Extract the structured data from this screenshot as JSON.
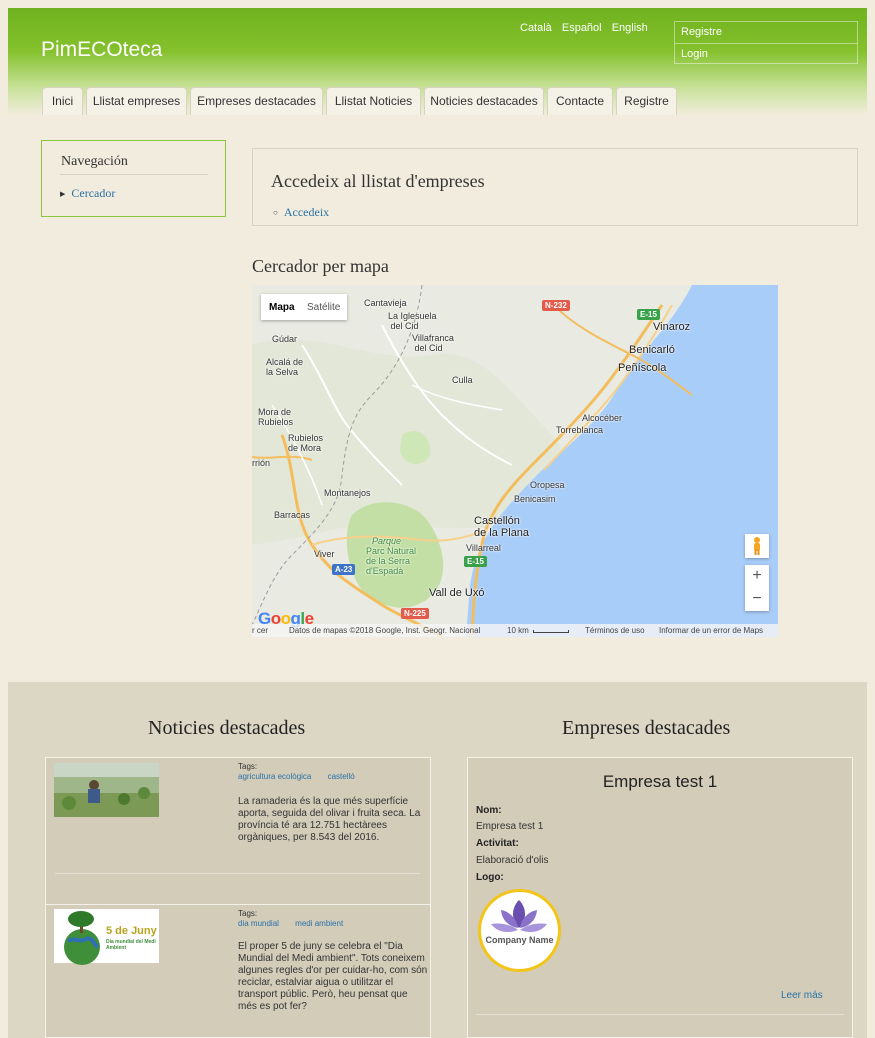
{
  "site": {
    "name": "PimECOteca"
  },
  "languages": [
    "Català",
    "Español",
    "English"
  ],
  "user_menu": {
    "register": "Registre",
    "login": "Login"
  },
  "tabs": [
    "Inici",
    "Llistat empreses",
    "Empreses destacades",
    "Llistat Noticies",
    "Noticies destacades",
    "Contacte",
    "Registre"
  ],
  "sidebar": {
    "title": "Navegación",
    "items": [
      "Cercador"
    ]
  },
  "listing": {
    "title": "Accedeix al llistat d'empreses",
    "link": "Accedeix"
  },
  "map": {
    "title": "Cercador per mapa",
    "type_buttons": [
      "Mapa",
      "Satélite"
    ],
    "labels": {
      "cantavieja": "Cantavieja",
      "iglesuela": "La Iglesuela\n del Cid",
      "villafranca": "Villafranca\n del Cid",
      "gudar": "Gúdar",
      "alcala": "Alcalá de\nla Selva",
      "vinaroz": "Vinaroz",
      "benicarlo": "Benicarló",
      "peniscola": "Peñíscola",
      "culla": "Culla",
      "mora": "Mora de\nRubielos",
      "rubielos": "Rubielos\nde Mora",
      "alcocebre": "Alcocéber",
      "torreblanca": "Torreblanca",
      "teruel": "rrión",
      "oropesa": "Oropesa",
      "montanejos": "Montanejos",
      "benicasim": "Benicasim",
      "barracas": "Barracas",
      "castellon": "Castellón\nde la Plana",
      "villarreal": "Villarreal",
      "viver": "Viver",
      "parque": "Parque",
      "parc": "Parc Natural\nde la Serra\nd'Espadà",
      "valldeuxo": "Vall de Uxó"
    },
    "shields": {
      "n232": "N-232",
      "e15a": "E-15",
      "e15b": "E-15",
      "a23": "A-23",
      "n225": "N-225"
    },
    "attribution": {
      "left": "r cer",
      "data": "Datos de mapas ©2018 Google, Inst. Geogr. Nacional",
      "scale": "10 km",
      "terms": "Términos de uso",
      "report": "Informar de un error de Maps"
    },
    "logo": "Google",
    "zoom_in": "+",
    "zoom_out": "−",
    "colors": {
      "sea": "#a9cdf9",
      "land": "#e9eae2",
      "park": "#c3dfa6",
      "road": "#f3bd5d"
    }
  },
  "news_section": {
    "title": "Noticies destacades",
    "items": [
      {
        "tags_label": "Tags:",
        "tags": [
          "agricultura ecològica",
          "castelló"
        ],
        "text": "La ramaderia és la que més superfície aporta, seguida del olivar i fruita seca. La província té ara 12.751 hectàrees orgàniques, per 8.543 del 2016."
      },
      {
        "tags_label": "Tags:",
        "tags": [
          "dia mundial",
          "medi ambient"
        ],
        "text": "El proper 5 de juny se celebra el \"Dia Mundial del Medi ambient\". Tots coneixem algunes regles d'or per cuidar-ho, com són reciclar, estalviar aigua o utilitzar el transport públic. Però, heu pensat que més es pot fer?",
        "thumb_title": "5 de Juny",
        "thumb_subtitle": "Dia mundial del Medi Ambient"
      }
    ]
  },
  "companies_section": {
    "title": "Empreses destacades",
    "company": {
      "name": "Empresa test 1",
      "nom_label": "Nom:",
      "nom_value": "Empresa test 1",
      "activitat_label": "Activitat:",
      "activitat_value": "Elaboració d'olis",
      "logo_label": "Logo:",
      "logo_text": "Company Name",
      "more": "Leer más"
    }
  }
}
